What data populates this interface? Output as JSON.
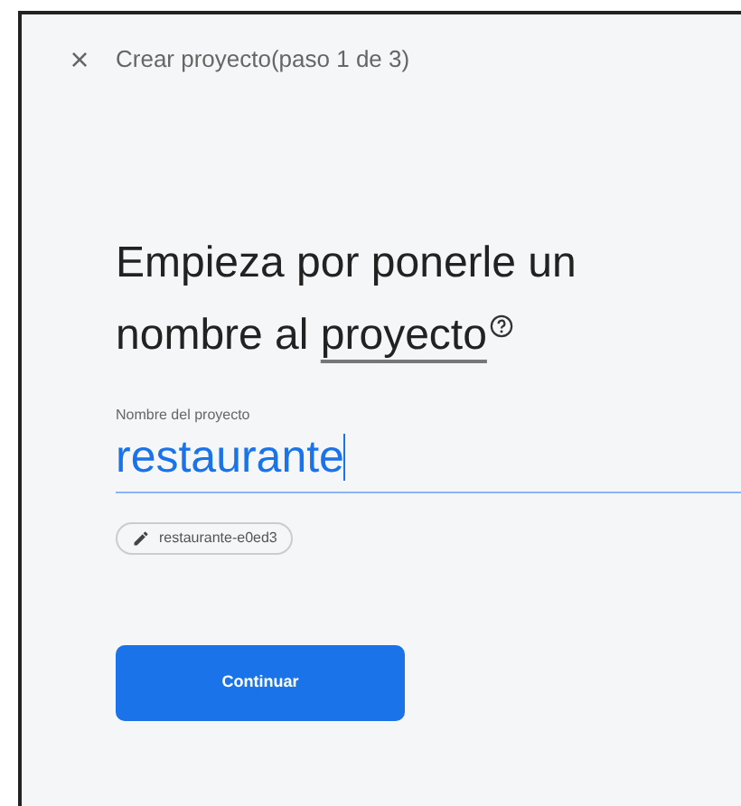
{
  "header": {
    "close_icon": "×",
    "title": "Crear proyecto(paso 1 de 3)"
  },
  "heading": {
    "text": "Empieza por ponerle un nombre al ",
    "link": "proyecto"
  },
  "project_name_field": {
    "label": "Nombre del proyecto",
    "value": "restaurante"
  },
  "project_id_chip": {
    "text": "restaurante-e0ed3"
  },
  "buttons": [
    {
      "label": "Continuar"
    }
  ]
}
